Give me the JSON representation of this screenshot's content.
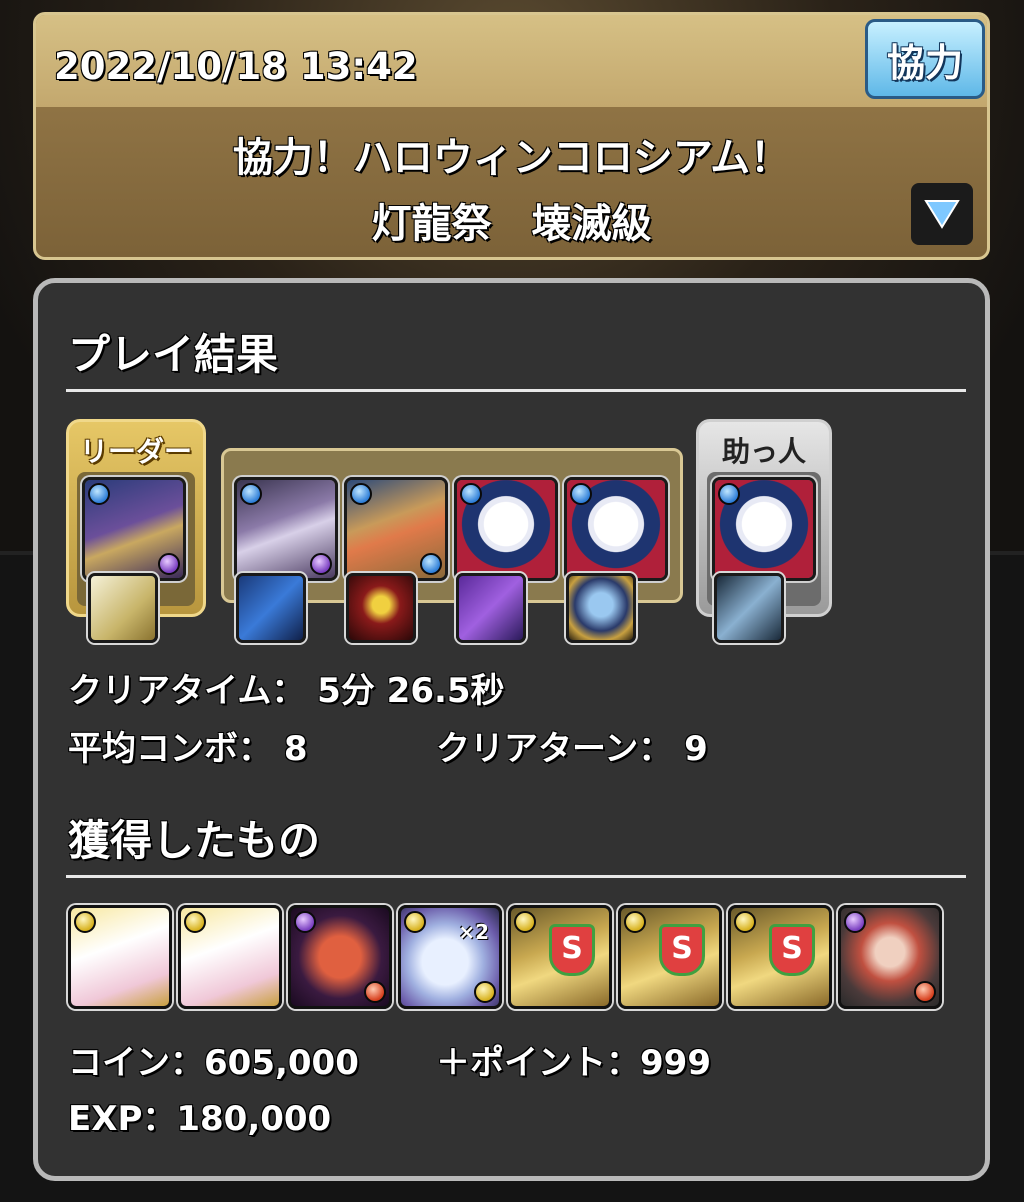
{
  "header": {
    "datetime": "2022/10/18 13:42",
    "mode_badge": "協力",
    "dungeon_title": "協力！ハロウィンコロシアム！",
    "floor_title": "灯龍祭　壊滅級",
    "expand_icon": "triangle-down-icon"
  },
  "result": {
    "section_title": "プレイ結果",
    "leader_label": "リーダー",
    "helper_label": "助っ人",
    "clear_time_label": "クリアタイム：",
    "clear_time_value": "5分 26.5秒",
    "avg_combo_label": "平均コンボ：",
    "avg_combo_value": "8",
    "clear_turn_label": "クリアターン：",
    "clear_turn_value": "9"
  },
  "team": [
    {
      "slot": "leader",
      "attr_main": "blue",
      "attr_sub": "purple"
    },
    {
      "slot": "sub1",
      "attr_main": "blue",
      "attr_sub": "purple"
    },
    {
      "slot": "sub2",
      "attr_main": "blue",
      "attr_sub": "blue"
    },
    {
      "slot": "sub3",
      "attr_main": "blue",
      "attr_sub": ""
    },
    {
      "slot": "sub4",
      "attr_main": "blue",
      "attr_sub": ""
    },
    {
      "slot": "helper",
      "attr_main": "blue",
      "attr_sub": ""
    }
  ],
  "rewards": {
    "section_title": "獲得したもの",
    "coin_label": "コイン：",
    "coin_value": "605,000",
    "points_label": "＋ポイント：",
    "points_value": "999",
    "exp_label": "EXP：",
    "exp_value": "180,000",
    "badge_text": "S",
    "multiplier_text": "×2",
    "items": [
      {
        "name": "king-cat-card",
        "attr": "yellow"
      },
      {
        "name": "king-cat-card",
        "attr": "yellow"
      },
      {
        "name": "dragon-card",
        "attr": "purple",
        "attr_sub": "red"
      },
      {
        "name": "ghost-x2-card",
        "attr": "yellow",
        "attr_sub": "yellow"
      },
      {
        "name": "s-egg-card",
        "attr": "yellow"
      },
      {
        "name": "s-egg-card",
        "attr": "yellow"
      },
      {
        "name": "s-egg-card",
        "attr": "yellow"
      },
      {
        "name": "girl-card",
        "attr": "purple",
        "attr_sub": "red"
      }
    ]
  },
  "colors": {
    "panel_bg": "#323232",
    "header_gold": "#c3a86e",
    "leader_gold": "#e6c766",
    "coop_blue": "#5fb8e8"
  }
}
